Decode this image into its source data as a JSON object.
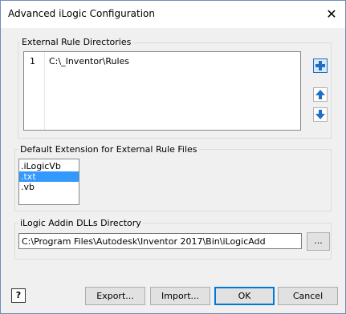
{
  "window": {
    "title": "Advanced iLogic Configuration",
    "close_glyph": "✕"
  },
  "external_rules": {
    "label": "External Rule Directories",
    "rows": [
      {
        "num": "1",
        "path": "C:\\_Inventor\\Rules"
      }
    ]
  },
  "default_ext": {
    "label": "Default Extension for External Rule Files",
    "options": [
      ".iLogicVb",
      ".txt",
      ".vb"
    ],
    "selected_index": 1
  },
  "addin": {
    "label": "iLogic Addin DLLs Directory",
    "path": "C:\\Program Files\\Autodesk\\Inventor 2017\\Bin\\iLogicAdd",
    "browse_label": "..."
  },
  "buttons": {
    "export": "Export...",
    "import": "Import...",
    "ok": "OK",
    "cancel": "Cancel",
    "help": "?"
  },
  "colors": {
    "selection": "#3399ff",
    "accent_blue": "#1f6fc6"
  }
}
